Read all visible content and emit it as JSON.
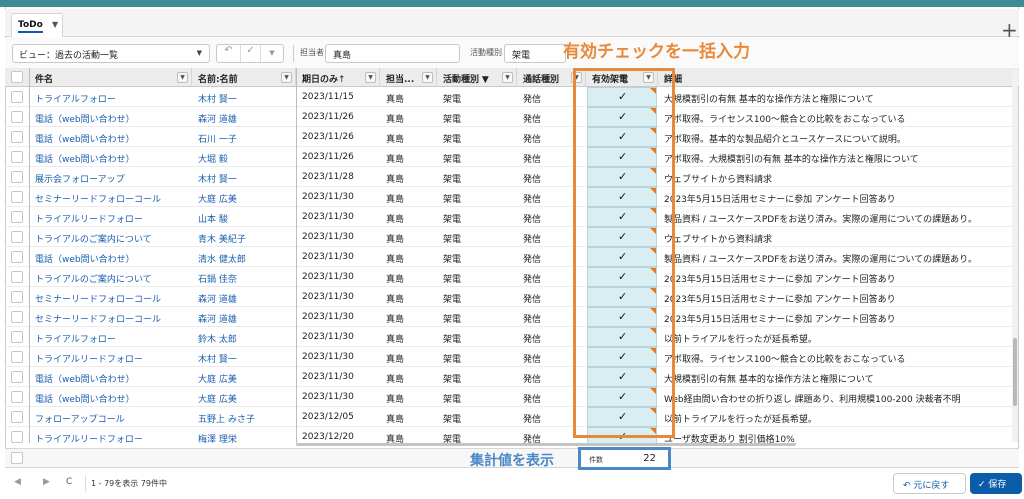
{
  "tab": {
    "label": "ToDo"
  },
  "toolbar": {
    "view_label": "ビュー：過去の活動一覧",
    "undo_icon": "↶",
    "check_icon": "✓",
    "owner_label": "担当者",
    "owner_value": "真島",
    "activity_label": "活動種別",
    "activity_value": "架電"
  },
  "columns": {
    "subject": "件名",
    "name": "名前:名前",
    "date": "期日のみ",
    "owner": "担当...",
    "activity": "活動種別",
    "calltype": "通話種別",
    "valid": "有効架電",
    "detail": "詳細"
  },
  "rows": [
    {
      "subject": "トライアルフォロー",
      "name": "木村 賢一",
      "date": "2023/11/15",
      "owner": "真島",
      "activity": "架電",
      "calltype": "発信",
      "detail": "大規模割引の有無 基本的な操作方法と権限について"
    },
    {
      "subject": "電話（web問い合わせ）",
      "name": "森河 道雄",
      "date": "2023/11/26",
      "owner": "真島",
      "activity": "架電",
      "calltype": "発信",
      "detail": "アポ取得。ライセンス100〜競合との比較をおこなっている"
    },
    {
      "subject": "電話（web問い合わせ）",
      "name": "石川 一子",
      "date": "2023/11/26",
      "owner": "真島",
      "activity": "架電",
      "calltype": "発信",
      "detail": "アポ取得。基本的な製品紹介とユースケースについて説明。"
    },
    {
      "subject": "電話（web問い合わせ）",
      "name": "大堀 毅",
      "date": "2023/11/26",
      "owner": "真島",
      "activity": "架電",
      "calltype": "発信",
      "detail": "アポ取得。大規模割引の有無 基本的な操作方法と権限について"
    },
    {
      "subject": "展示会フォローアップ",
      "name": "木村 賢一",
      "date": "2023/11/28",
      "owner": "真島",
      "activity": "架電",
      "calltype": "発信",
      "detail": "ウェブサイトから資料請求"
    },
    {
      "subject": "セミナーリードフォローコール",
      "name": "大庭 広美",
      "date": "2023/11/30",
      "owner": "真島",
      "activity": "架電",
      "calltype": "発信",
      "detail": "2023年5月15日活用セミナーに参加 アンケート回答あり"
    },
    {
      "subject": "トライアルリードフォロー",
      "name": "山本 駿",
      "date": "2023/11/30",
      "owner": "真島",
      "activity": "架電",
      "calltype": "発信",
      "detail": "製品資料 / ユースケースPDFをお送り済み。実際の運用についての課題あり。"
    },
    {
      "subject": "トライアルのご案内について",
      "name": "青木 美紀子",
      "date": "2023/11/30",
      "owner": "真島",
      "activity": "架電",
      "calltype": "発信",
      "detail": "ウェブサイトから資料請求"
    },
    {
      "subject": "電話（web問い合わせ）",
      "name": "清水 健太郎",
      "date": "2023/11/30",
      "owner": "真島",
      "activity": "架電",
      "calltype": "発信",
      "detail": "製品資料 / ユースケースPDFをお送り済み。実際の運用についての課題あり。"
    },
    {
      "subject": "トライアルのご案内について",
      "name": "石鍋 佳奈",
      "date": "2023/11/30",
      "owner": "真島",
      "activity": "架電",
      "calltype": "発信",
      "detail": "2023年5月15日活用セミナーに参加 アンケート回答あり"
    },
    {
      "subject": "セミナーリードフォローコール",
      "name": "森河 道雄",
      "date": "2023/11/30",
      "owner": "真島",
      "activity": "架電",
      "calltype": "発信",
      "detail": "2023年5月15日活用セミナーに参加 アンケート回答あり"
    },
    {
      "subject": "セミナーリードフォローコール",
      "name": "森河 道雄",
      "date": "2023/11/30",
      "owner": "真島",
      "activity": "架電",
      "calltype": "発信",
      "detail": "2023年5月15日活用セミナーに参加 アンケート回答あり"
    },
    {
      "subject": "トライアルフォロー",
      "name": "鈴木 太郎",
      "date": "2023/11/30",
      "owner": "真島",
      "activity": "架電",
      "calltype": "発信",
      "detail": "以前トライアルを行ったが延長希望。"
    },
    {
      "subject": "トライアルリードフォロー",
      "name": "木村 賢一",
      "date": "2023/11/30",
      "owner": "真島",
      "activity": "架電",
      "calltype": "発信",
      "detail": "アポ取得。ライセンス100〜競合との比較をおこなっている"
    },
    {
      "subject": "電話（web問い合わせ）",
      "name": "大庭 広美",
      "date": "2023/11/30",
      "owner": "真島",
      "activity": "架電",
      "calltype": "発信",
      "detail": "大規模割引の有無 基本的な操作方法と権限について"
    },
    {
      "subject": "電話（web問い合わせ）",
      "name": "大庭 広美",
      "date": "2023/11/30",
      "owner": "真島",
      "activity": "架電",
      "calltype": "発信",
      "detail": "Web経由問い合わせの折り返し 課題あり、利用規模100-200 決裁者不明"
    },
    {
      "subject": "フォローアップコール",
      "name": "五野上 みさ子",
      "date": "2023/12/05",
      "owner": "真島",
      "activity": "架電",
      "calltype": "発信",
      "detail": "以前トライアルを行ったが延長希望。"
    },
    {
      "subject": "トライアルリードフォロー",
      "name": "梅澤 理栄",
      "date": "2023/12/20",
      "owner": "真島",
      "activity": "架電",
      "calltype": "発信",
      "detail": "ユーザ数変更あり 割引価格10%"
    }
  ],
  "check_glyph": "✓",
  "summary": {
    "label": "件数",
    "value": "22"
  },
  "pager": {
    "first": "◀",
    "next": "▶",
    "refresh": "C",
    "info": "1 - 79を表示 79件中"
  },
  "buttons": {
    "undo": "↶ 元に戻す",
    "save": "✓ 保存"
  },
  "annotations": {
    "bulk": "有効チェックを一括入力",
    "total": "集計値を表示"
  },
  "colors": {
    "accent": "#0b5cab",
    "annotation_orange": "#e8893a",
    "annotation_blue": "#4a89c5",
    "checkcell": "#d9eef3"
  }
}
